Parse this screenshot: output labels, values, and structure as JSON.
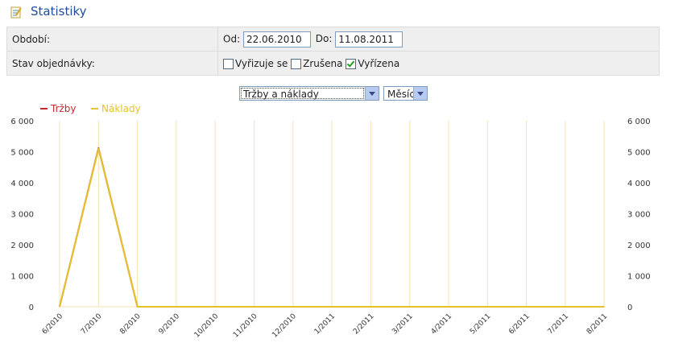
{
  "header": {
    "title": "Statistiky",
    "icon": "statistics-icon"
  },
  "filters": {
    "period_label": "Období:",
    "from_label": "Od:",
    "from_value": "22.06.2010",
    "to_label": "Do:",
    "to_value": "11.08.2011",
    "status_label": "Stav objednávky:",
    "statuses": [
      {
        "label": "Vyřizuje se",
        "checked": false
      },
      {
        "label": "Zrušena",
        "checked": false
      },
      {
        "label": "Vyřízena",
        "checked": true
      }
    ]
  },
  "controls": {
    "metric_select": "Tržby a náklady",
    "period_select": "Měsíc"
  },
  "chart_data": {
    "type": "line",
    "categories": [
      "6/2010",
      "7/2010",
      "8/2010",
      "9/2010",
      "10/2010",
      "11/2010",
      "12/2010",
      "1/2011",
      "2/2011",
      "3/2011",
      "4/2011",
      "5/2011",
      "6/2011",
      "7/2011",
      "8/2011"
    ],
    "series": [
      {
        "name": "Tržby",
        "color": "#c0282d",
        "values": [
          0,
          5120,
          0,
          0,
          0,
          0,
          0,
          0,
          0,
          0,
          0,
          0,
          0,
          0,
          0
        ]
      },
      {
        "name": "Náklady",
        "color": "#e6c229",
        "values": [
          0,
          5100,
          0,
          0,
          0,
          0,
          0,
          0,
          0,
          0,
          0,
          0,
          0,
          0,
          0
        ]
      }
    ],
    "yticks": [
      "0",
      "1 000",
      "2 000",
      "3 000",
      "4 000",
      "5 000",
      "6 000"
    ],
    "ylim": [
      0,
      6000
    ],
    "grid": "vertical",
    "legend": "top-left",
    "title": "",
    "xlabel": "",
    "ylabel": ""
  }
}
